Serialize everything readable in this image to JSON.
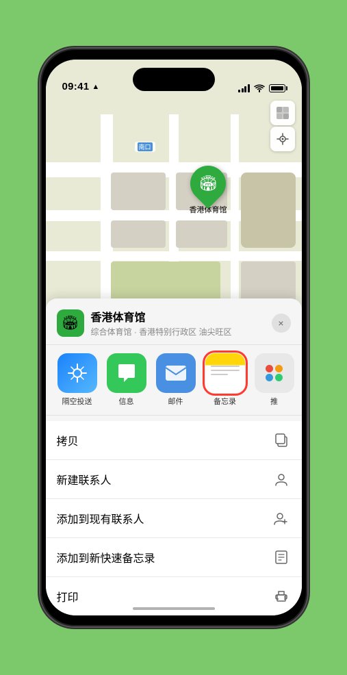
{
  "status_bar": {
    "time": "09:41",
    "location_arrow": "▶"
  },
  "map": {
    "road_label_badge": "南口",
    "controls": {
      "map_icon": "🗺",
      "location_icon": "➤"
    }
  },
  "stadium_pin": {
    "label": "香港体育馆",
    "emoji": "🏟"
  },
  "bottom_sheet": {
    "venue_icon": "🏟",
    "venue_name": "香港体育馆",
    "venue_subtitle": "综合体育馆 · 香港特别行政区 油尖旺区",
    "close_label": "×",
    "share_items": [
      {
        "label": "隔空投送",
        "type": "airdrop"
      },
      {
        "label": "信息",
        "type": "messages"
      },
      {
        "label": "邮件",
        "type": "mail"
      },
      {
        "label": "备忘录",
        "type": "notes"
      },
      {
        "label": "推",
        "type": "more"
      }
    ],
    "actions": [
      {
        "label": "拷贝",
        "icon": "copy"
      },
      {
        "label": "新建联系人",
        "icon": "person"
      },
      {
        "label": "添加到现有联系人",
        "icon": "person-add"
      },
      {
        "label": "添加到新快速备忘录",
        "icon": "note"
      },
      {
        "label": "打印",
        "icon": "print"
      }
    ]
  }
}
